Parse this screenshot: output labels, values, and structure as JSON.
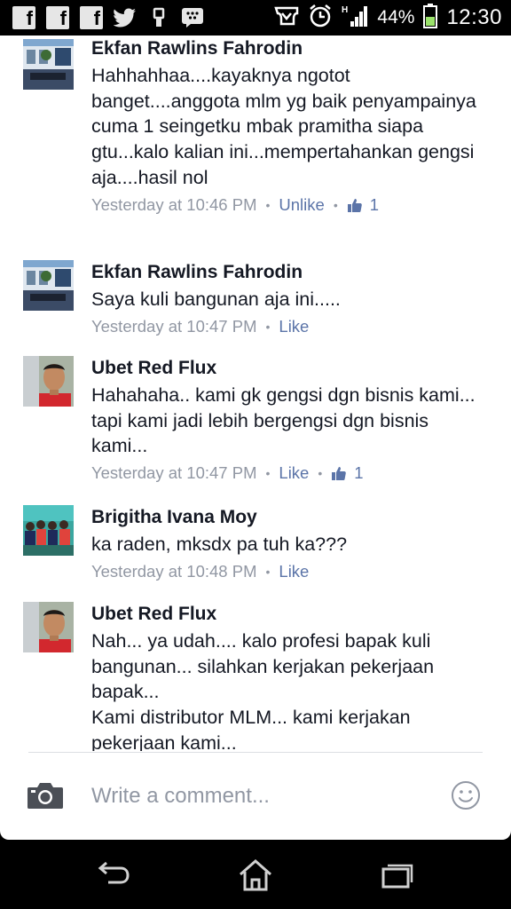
{
  "status_bar": {
    "notification_icons": [
      "facebook-icon",
      "facebook-icon",
      "facebook-icon",
      "twitter-icon",
      "usb-icon",
      "bbm-icon"
    ],
    "status_icons": [
      "media-icon",
      "alarm-icon",
      "signal-icon"
    ],
    "signal_type": "H",
    "battery_percent": "44%",
    "time": "12:30"
  },
  "comments": [
    {
      "author": "Ekfan Rawlins Fahrodin",
      "text": "Hahhahhaa....kayaknya ngotot banget....anggota mlm yg baik penyampainya cuma 1 seingetku mbak pramitha siapa gtu...kalo kalian ini...mempertahankan gengsi aja....hasil nol",
      "time": "Yesterday at 10:46 PM",
      "action": "Unlike",
      "likes": "1"
    },
    {
      "author": "Ekfan Rawlins Fahrodin",
      "text": "Saya kuli bangunan aja ini.....",
      "time": "Yesterday at 10:47 PM",
      "action": "Like",
      "likes": ""
    },
    {
      "author": "Ubet Red Flux",
      "text": "Hahahaha.. kami gk gengsi dgn bisnis kami... tapi kami jadi lebih bergengsi dgn bisnis kami...",
      "time": "Yesterday at 10:47 PM",
      "action": "Like",
      "likes": "1"
    },
    {
      "author": "Brigitha Ivana Moy",
      "text": "ka raden, mksdx pa tuh ka???",
      "time": "Yesterday at 10:48 PM",
      "action": "Like",
      "likes": ""
    },
    {
      "author": "Ubet Red Flux",
      "text": "Nah... ya udah.... kalo profesi bapak kuli bangunan... silahkan kerjakan pekerjaan bapak...\nKami distributor MLM... kami kerjakan pekerjaan kami...",
      "time": "",
      "action": "",
      "likes": ""
    }
  ],
  "composer": {
    "placeholder": "Write a comment...",
    "left_icon": "camera-icon",
    "right_icon": "smiley-icon"
  },
  "nav_bar": {
    "buttons": [
      "back-icon",
      "home-icon",
      "recent-apps-icon"
    ]
  },
  "colors": {
    "link": "#5b74a8",
    "meta": "#9197a3",
    "text": "#141823",
    "battery": "#9be36b"
  }
}
